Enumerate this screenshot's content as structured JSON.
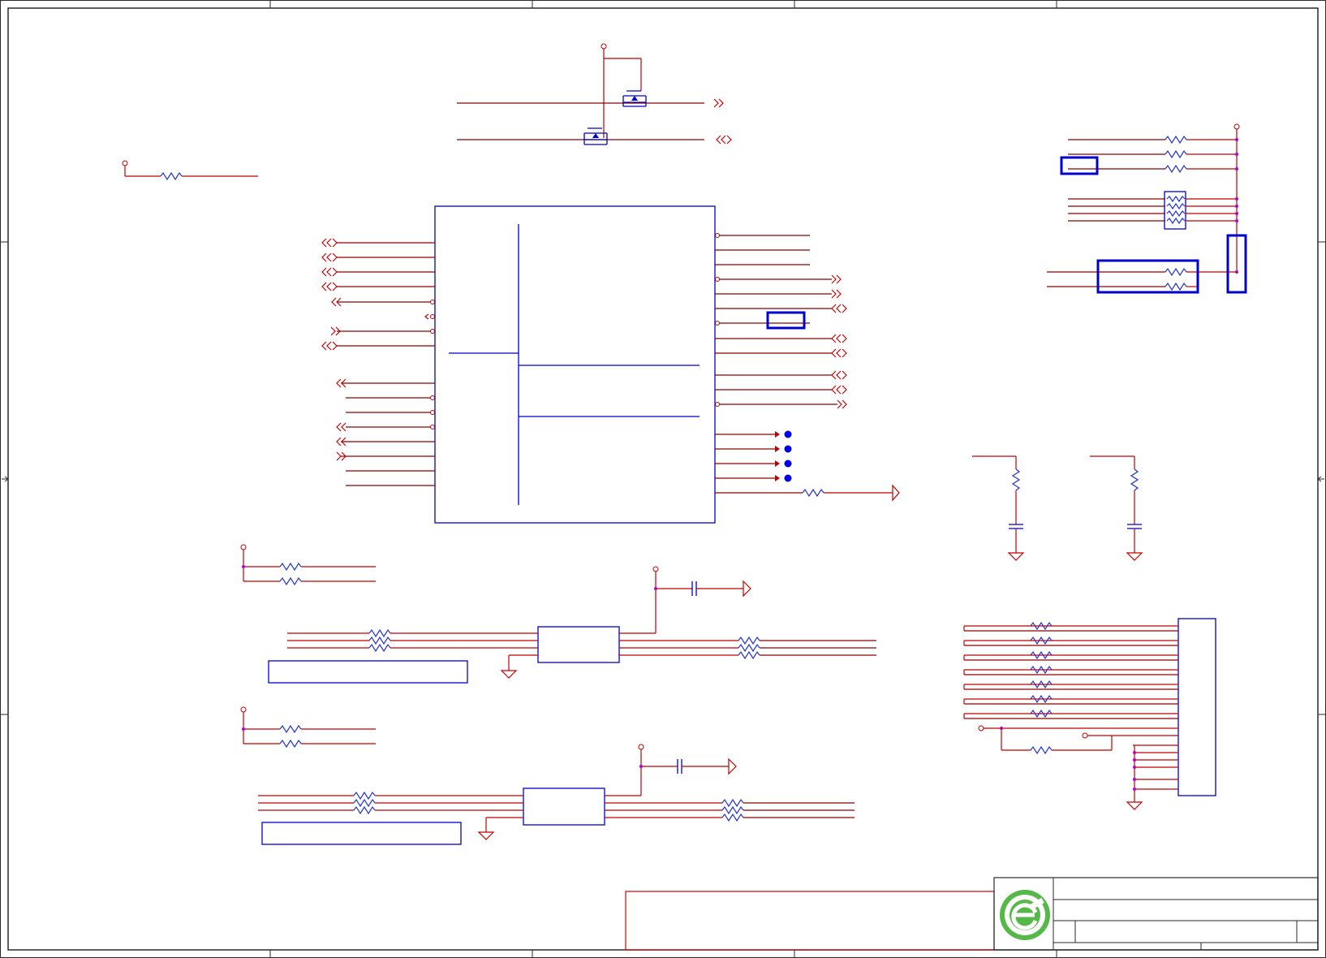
{
  "sheet": {
    "colors": {
      "wire": "#c00000",
      "component": "#0000cc",
      "junction": "#c000c0",
      "frame": "#2a2a2a",
      "logo_green": "#55b848"
    },
    "border_markers": {
      "left_arrow": "left-pointer",
      "right_arrow": "right-pointer"
    },
    "title_block": {
      "logo": "company-logo-green-e",
      "fields": []
    }
  }
}
